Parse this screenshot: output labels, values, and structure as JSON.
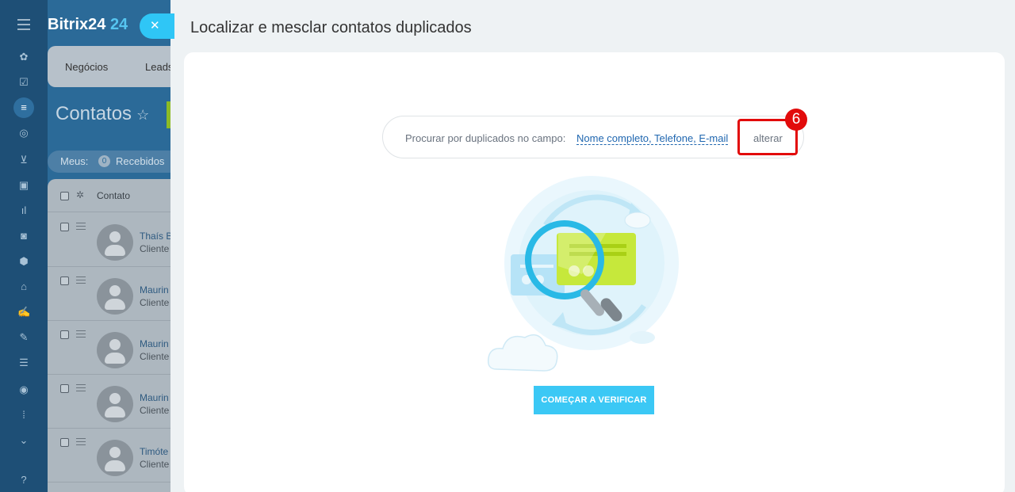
{
  "app": {
    "logo": "Bitrix24",
    "logo_suffix": "24",
    "tabs": [
      "Negócios",
      "Leads"
    ],
    "page_title": "Contatos",
    "filter": {
      "label": "Meus:",
      "count": "0",
      "received": "Recebidos"
    },
    "grid_header": "Contato",
    "rows": [
      {
        "name": "Thaís B",
        "type": "Cliente"
      },
      {
        "name": "Maurin",
        "type": "Cliente"
      },
      {
        "name": "Maurin",
        "type": "Cliente"
      },
      {
        "name": "Maurin",
        "type": "Cliente"
      },
      {
        "name": "Timóte",
        "type": "Cliente"
      }
    ]
  },
  "slider": {
    "title": "Localizar e mesclar contatos duplicados",
    "close_icon": "close-icon",
    "search": {
      "prefix": "Procurar por duplicados no campo:",
      "fields": "Nome completo, Telefone, E-mail",
      "change": "alterar"
    },
    "annotation_number": "6",
    "start_button": "COMEÇAR A VERIFICAR"
  },
  "colors": {
    "accent": "#3bc8f5",
    "highlight": "#e20b0b",
    "link": "#2067b0"
  }
}
